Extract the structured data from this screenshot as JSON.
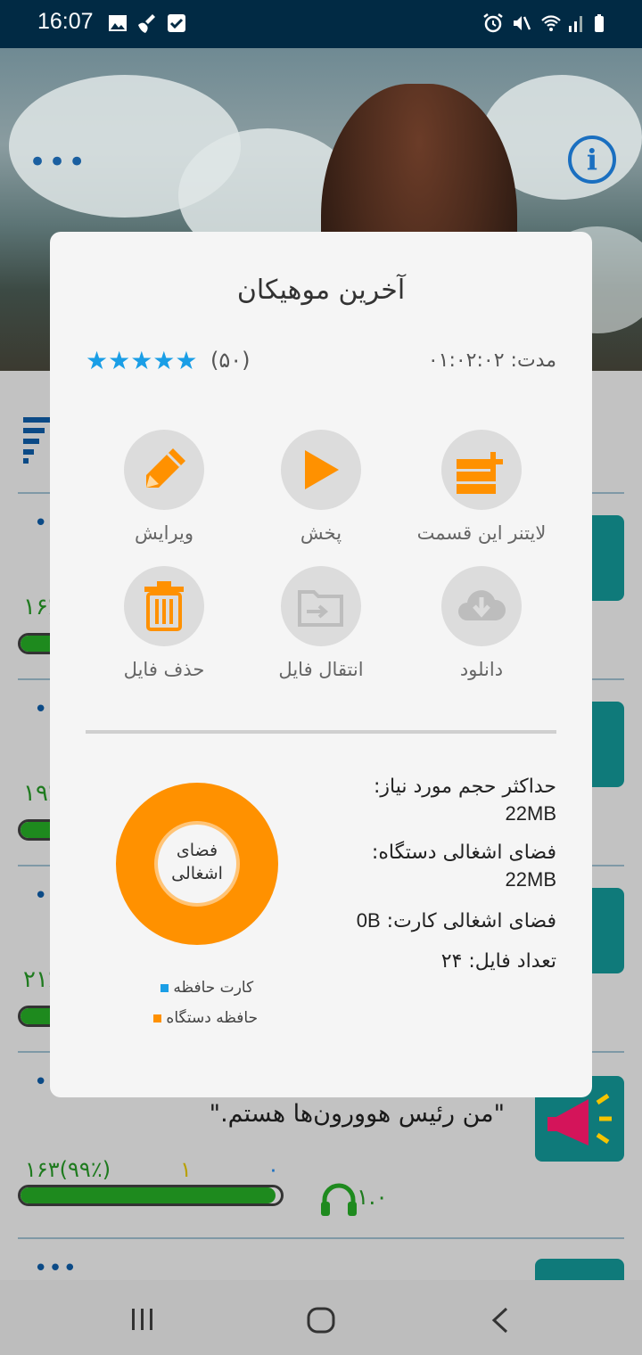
{
  "status_bar": {
    "time": "16:07",
    "icons": [
      "image-icon",
      "broom-icon",
      "check-box-icon",
      "alarm-icon",
      "mute-icon",
      "wifi-icon",
      "signal-icon",
      "battery-icon"
    ]
  },
  "hero": {
    "menu_icon": "more-dots-icon",
    "info_icon": "info-icon",
    "info_glyph": "i",
    "dots": "•••"
  },
  "list": {
    "rows": [
      {
        "dots": "•••",
        "count": "۱۶٪"
      },
      {
        "dots": "•••",
        "count": "۱۹٪"
      },
      {
        "dots": "•••",
        "count": "۲۱٪"
      }
    ],
    "last_row": {
      "dots": "•••",
      "quote": "\"من رئیس هوورون‌ها هستم.\"",
      "stat_downloads": "۱۶۳(۹۹٪)",
      "stat_likes": "۱",
      "stat_zero": "۰",
      "rate": "۱.۰"
    },
    "partial_dots": "•••"
  },
  "dialog": {
    "title": "آخرین موهیکان",
    "stars": "★★★★★",
    "rating_count": "(۵۰)",
    "duration": "مدت: ۰۱:۰۲:۰۲",
    "actions": [
      {
        "label": "لایتنر این قسمت",
        "icon": "add-to-leitner-icon"
      },
      {
        "label": "پخش",
        "icon": "play-icon"
      },
      {
        "label": "ویرایش",
        "icon": "pencil-icon"
      },
      {
        "label": "دانلود",
        "icon": "cloud-download-icon"
      },
      {
        "label": "انتقال فایل",
        "icon": "folder-move-icon"
      },
      {
        "label": "حذف فایل",
        "icon": "trash-icon"
      }
    ],
    "storage": {
      "max_label": "حداکثر حجم مورد نیاز:",
      "max_value": "22MB",
      "device_label": "فضای اشغالی دستگاه:",
      "device_value": "22MB",
      "card_label": "فضای اشغالی کارت:",
      "card_value": "0B",
      "files_label": "تعداد فایل:",
      "files_value": "۲۴"
    },
    "donut": {
      "center_line1": "فضای",
      "center_line2": "اشغالی",
      "device_fraction": 1.0,
      "device_color": "#ff9100",
      "card_color": "#1a9ee6"
    },
    "legend": {
      "card": "کارت حافظه",
      "device": "حافظه دستگاه"
    }
  },
  "nav": {
    "recent_icon": "recent-apps-icon",
    "home_icon": "home-icon",
    "back_icon": "back-icon"
  }
}
